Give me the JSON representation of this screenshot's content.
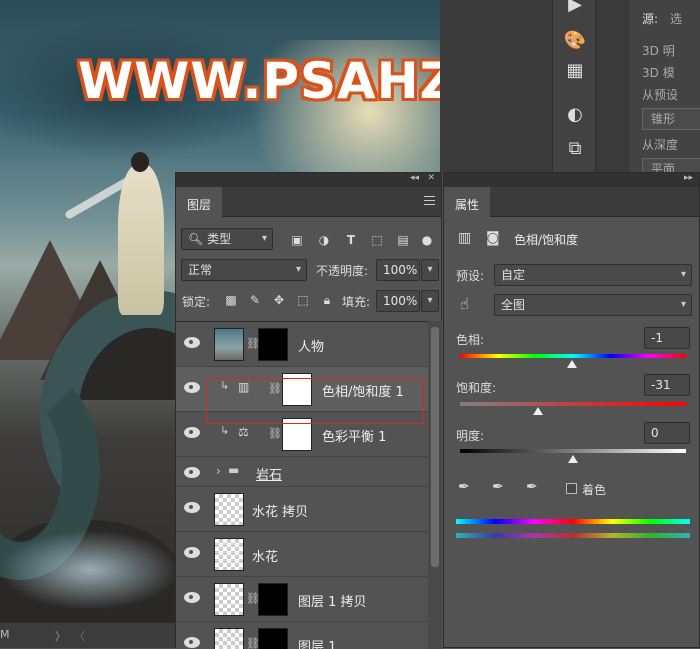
{
  "watermark": "WWW.PSAHZ.COM",
  "canvas_status": {
    "zoom": "M",
    "nav_next": "〉",
    "nav_prev": "〈"
  },
  "props3d": {
    "source_label": "源:",
    "source_value": "选",
    "options": [
      "3D 明",
      "3D 模",
      "从预设",
      "从深度"
    ],
    "buttons": [
      "锥形",
      "平面"
    ]
  },
  "layers_panel": {
    "tab": "图层",
    "filter_kind": "类型",
    "blend_mode": "正常",
    "opacity_label": "不透明度:",
    "opacity": "100%",
    "lock_label": "锁定:",
    "fill_label": "填充:",
    "fill": "100%",
    "layers": [
      {
        "name": "人物",
        "type": "masked"
      },
      {
        "name": "色相/饱和度 1",
        "type": "adjustment-hue"
      },
      {
        "name": "色彩平衡 1",
        "type": "adjustment-balance"
      },
      {
        "name": "岩石",
        "type": "group"
      },
      {
        "name": "水花 拷贝",
        "type": "smart"
      },
      {
        "name": "水花",
        "type": "smart"
      },
      {
        "name": "图层 1 拷贝",
        "type": "masked"
      },
      {
        "name": "图层 1",
        "type": "masked"
      }
    ]
  },
  "properties_panel": {
    "tab": "属性",
    "title": "色相/饱和度",
    "preset_label": "预设:",
    "preset_value": "自定",
    "channel_value": "全图",
    "hue_label": "色相:",
    "hue": "-1",
    "hue_fraction": 0.497,
    "saturation_label": "饱和度:",
    "saturation": "-31",
    "saturation_fraction": 0.345,
    "lightness_label": "明度:",
    "lightness": "0",
    "lightness_fraction": 0.5,
    "colorize_label": "着色"
  },
  "colors": {
    "highlight_border": "#d9281c",
    "watermark_outline": "#d9521c"
  }
}
